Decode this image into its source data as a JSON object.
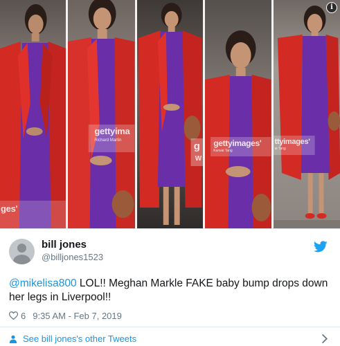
{
  "photos": {
    "watermarks": {
      "p1": "ges'",
      "p2_brand": "gettyima",
      "p2_credit": "Richard Martin",
      "p3": "g",
      "p3_sub": "W",
      "p4_brand": "gettyimages'",
      "p4_credit": "Karwai Tang",
      "p5_brand": "ttyimages'",
      "p5_credit": "ai Tang"
    },
    "info_glyph": "i"
  },
  "tweet": {
    "display_name": "bill jones",
    "handle": "@billjones1523",
    "mention": "@mikelisa800",
    "body": " LOL!! Meghan Markle FAKE baby bump drops down her legs in Liverpool!!",
    "like_count": "6",
    "timestamp": "9:35 AM - Feb 7, 2019",
    "footer_link": "See bill jones's other Tweets"
  },
  "colors": {
    "coat_red": "#d42a24",
    "dress_purple": "#6a2fa8",
    "twitter_blue": "#1b95e0",
    "secondary_text": "#657786"
  }
}
